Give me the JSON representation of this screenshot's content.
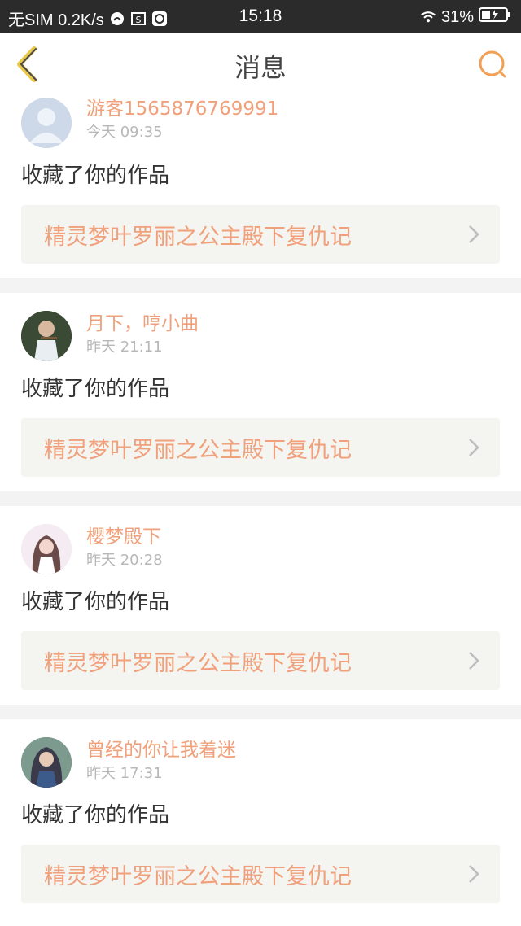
{
  "status_bar": {
    "carrier": "无SIM 0.2K/s",
    "time": "15:18",
    "battery_pct": "31%"
  },
  "header": {
    "title": "消息",
    "accent_color": "#f2a055"
  },
  "messages": [
    {
      "username": "游客1565876769991",
      "time": "今天 09:35",
      "action": "收藏了你的作品",
      "work_title": "精灵梦叶罗丽之公主殿下复仇记"
    },
    {
      "username": "月下，哼小曲",
      "time": "昨天 21:11",
      "action": "收藏了你的作品",
      "work_title": "精灵梦叶罗丽之公主殿下复仇记"
    },
    {
      "username": "樱梦殿下",
      "time": "昨天 20:28",
      "action": "收藏了你的作品",
      "work_title": "精灵梦叶罗丽之公主殿下复仇记"
    },
    {
      "username": "曾经的你让我着迷",
      "time": "昨天 17:31",
      "action": "收藏了你的作品",
      "work_title": "精灵梦叶罗丽之公主殿下复仇记"
    }
  ],
  "colors": {
    "username": "#f0a07a",
    "work_bg": "#f4f4f1",
    "status_bg": "#2b2b2b"
  }
}
